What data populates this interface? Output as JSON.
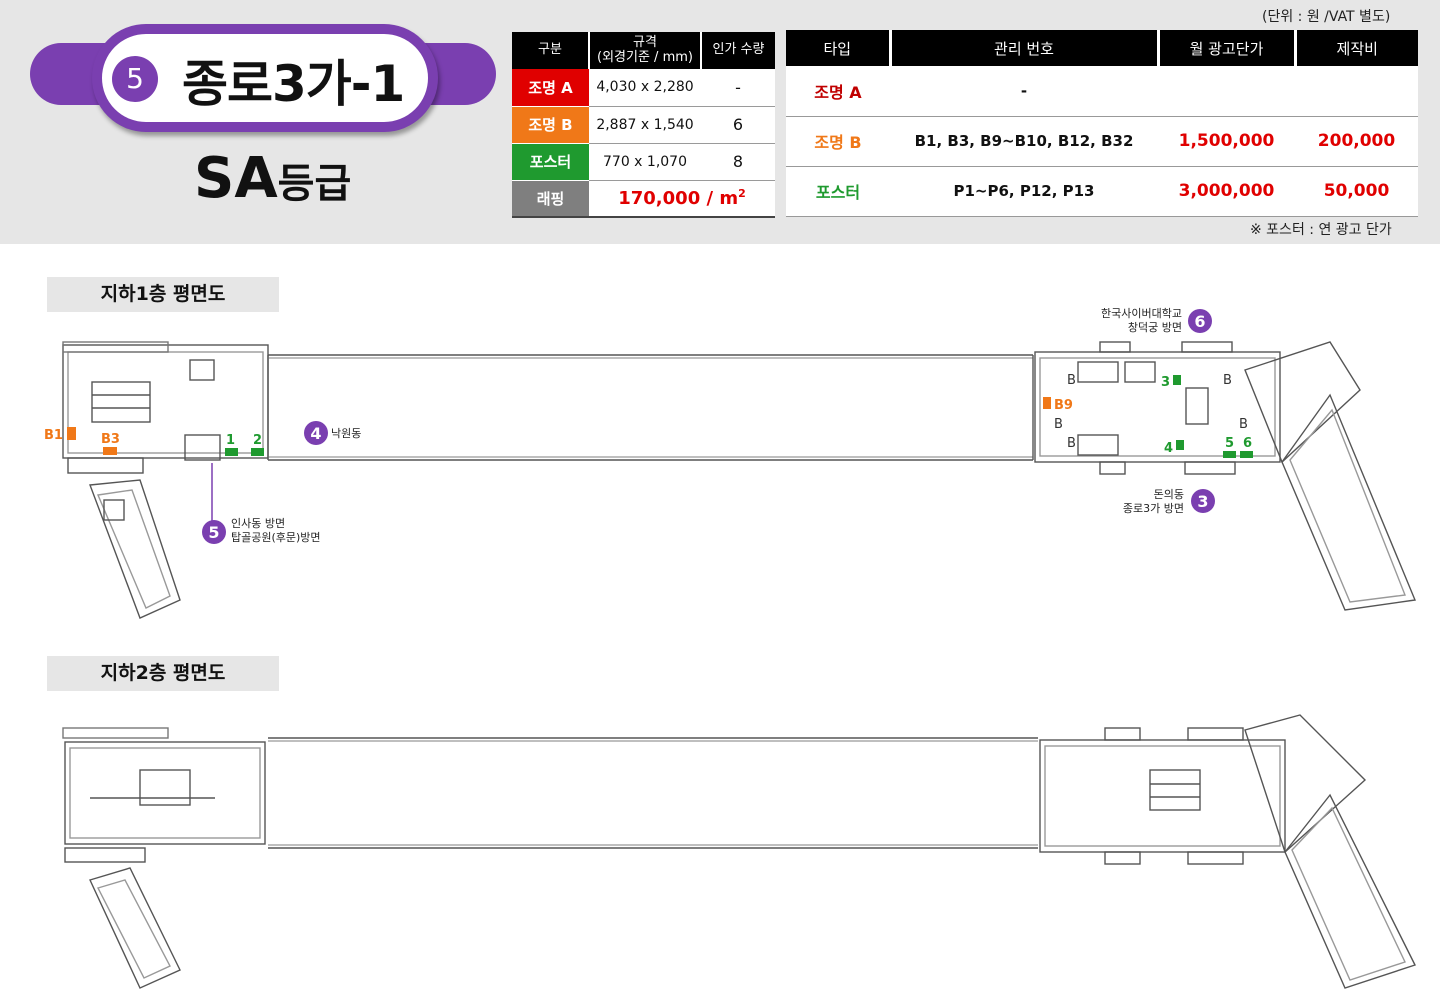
{
  "header": {
    "unit_note": "(단위 : 원 /VAT 별도)",
    "station_number": "5",
    "station_name": "종로3가-1",
    "grade_main": "SA",
    "grade_suffix": "등급",
    "poster_note": "※ 포스터 : 연 광고 단가",
    "colors": {
      "purple": "#7a3fb0",
      "red": "#e00000",
      "orange": "#f07818",
      "green": "#1f9a2f",
      "gray": "#7f7f7f"
    }
  },
  "spec_table": {
    "headers": [
      "구분",
      "규격",
      "(외경기준 / mm)",
      "인가 수량"
    ],
    "rows": [
      {
        "type": "조명 A",
        "size": "4,030 x 2,280",
        "qty": "-"
      },
      {
        "type": "조명 B",
        "size": "2,887 x 1,540",
        "qty": "6"
      },
      {
        "type": "포스터",
        "size": "770 x 1,070",
        "qty": "8"
      }
    ],
    "wrap": {
      "type": "래핑",
      "price": "170,000 / m",
      "price_sup": "2"
    }
  },
  "price_table": {
    "headers": [
      "타입",
      "관리 번호",
      "월 광고단가",
      "제작비"
    ],
    "rows": [
      {
        "type": "조명 A",
        "codes": "-",
        "monthly": "",
        "production": ""
      },
      {
        "type": "조명 B",
        "codes": "B1, B3, B9~B10, B12, B32",
        "monthly": "1,500,000",
        "production": "200,000"
      },
      {
        "type": "포스터",
        "codes": "P1~P6, P12, P13",
        "monthly": "3,000,000",
        "production": "50,000"
      }
    ]
  },
  "floor_b1": {
    "label": "지하1층 평면도",
    "exits": [
      {
        "num": "6",
        "line1": "한국사이버대학교",
        "line2": "창덕궁 방면"
      },
      {
        "num": "4",
        "line1": "낙원동",
        "line2": ""
      },
      {
        "num": "5",
        "line1": "인사동 방면",
        "line2": "탑골공원(후문)방면"
      },
      {
        "num": "3",
        "line1": "돈의동",
        "line2": "종로3가 방면"
      }
    ],
    "markers": {
      "b1": "B1",
      "b3": "B3",
      "b9": "B9",
      "p1": "1",
      "p2": "2",
      "p3": "3",
      "p4": "4",
      "p5": "5",
      "p6": "6",
      "b": "B"
    }
  },
  "floor_b2": {
    "label": "지하2층 평면도"
  }
}
